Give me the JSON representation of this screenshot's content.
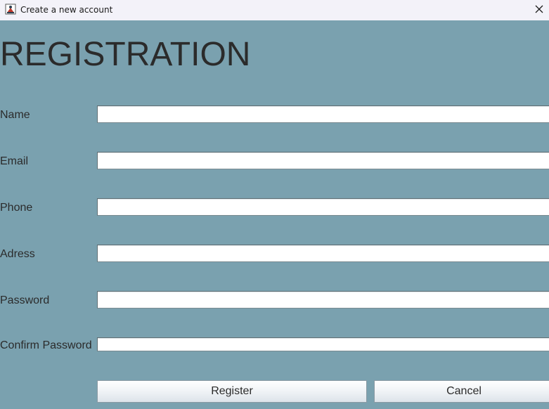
{
  "window": {
    "title": "Create a new account",
    "icon": "java-app-icon",
    "close_icon": "close-icon"
  },
  "form": {
    "heading": "REGISTRATION",
    "fields": [
      {
        "label": "Name",
        "value": ""
      },
      {
        "label": "Email",
        "value": ""
      },
      {
        "label": "Phone",
        "value": ""
      },
      {
        "label": "Adress",
        "value": ""
      },
      {
        "label": "Password",
        "value": ""
      },
      {
        "label": "Confirm Password",
        "value": ""
      }
    ],
    "register_label": "Register",
    "cancel_label": "Cancel"
  },
  "colors": {
    "background": "#7aa1af",
    "titlebar": "#f3f2f9",
    "text": "#2b2b2b"
  }
}
